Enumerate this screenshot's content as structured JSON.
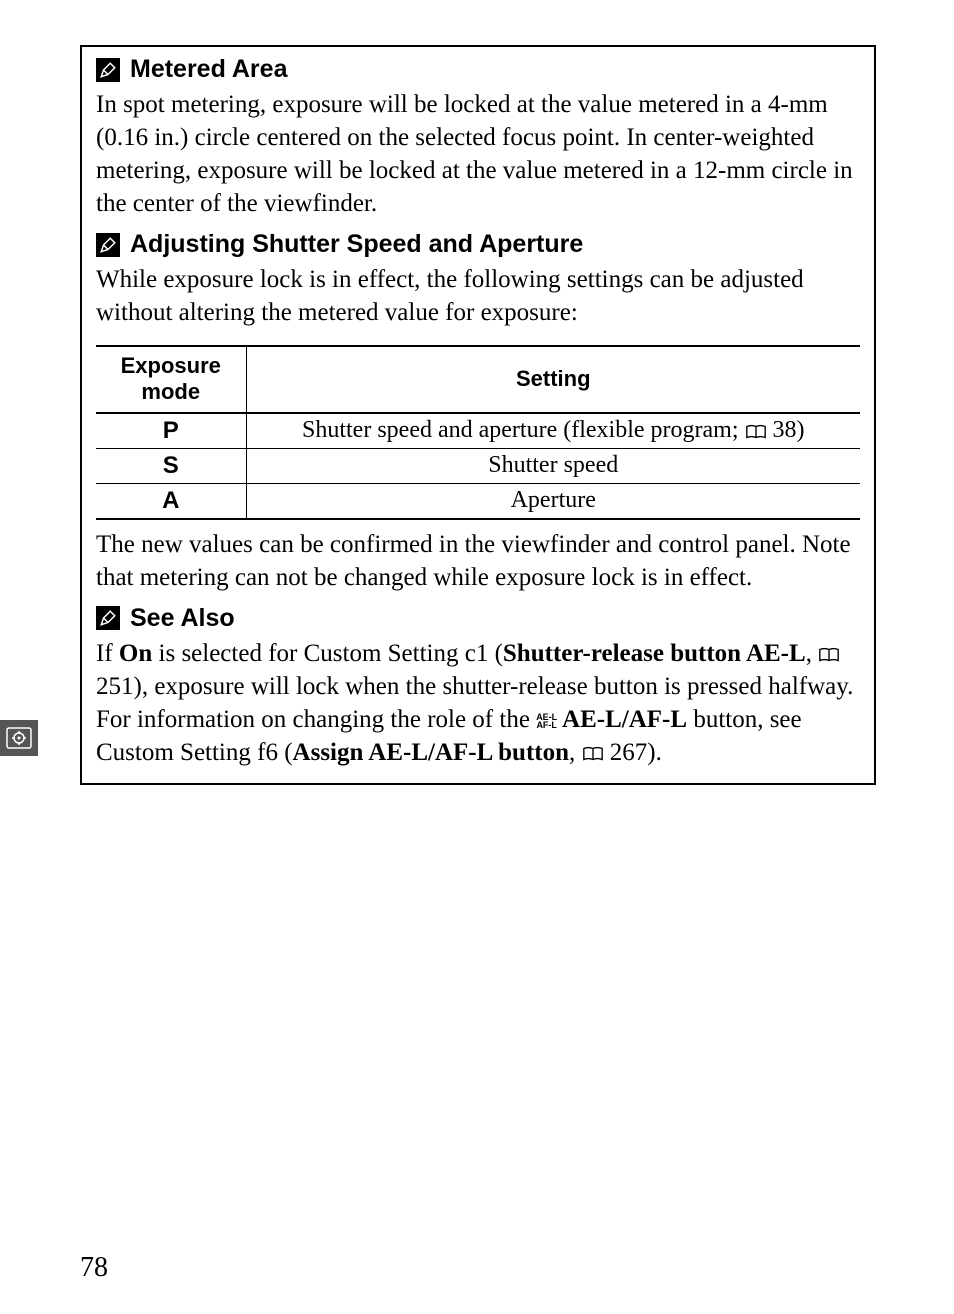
{
  "sections": {
    "metered": {
      "title": "Metered Area",
      "body": "In spot metering, exposure will be locked at the value metered in a 4-mm (0.16 in.) circle centered on the selected focus point. In center-weighted metering, exposure will be locked at the value metered in a 12-mm circle in the center of the viewfinder."
    },
    "adjusting": {
      "title": "Adjusting Shutter Speed and Aperture",
      "intro": "While exposure lock is in effect, the following settings can be adjusted without altering the metered value for exposure:",
      "after": "The new values can be confirmed in the viewfinder and control panel. Note that metering can not be changed while exposure lock is in effect."
    },
    "seealso": {
      "title": "See Also",
      "p1a": "If ",
      "p1_on": "On",
      "p1b": " is selected for Custom Setting c1 (",
      "p1_srb": "Shutter-release button AE-L",
      "p1c": ", ",
      "ref1": " 251), exposure will lock when the shutter-release button is pressed halfway.  For information on changing the role of the ",
      "aelabel": " AE-L/AF-L",
      "after_ael": " button, see Custom Setting f6 (",
      "assign": "Assign AE-L/AF-L button",
      "p2": ", ",
      "ref2": " 267)."
    }
  },
  "table": {
    "headers": {
      "mode": "Exposure mode",
      "setting": "Setting"
    },
    "rows": [
      {
        "mode": "P",
        "setting_pre": "Shutter speed and aperture (flexible program; ",
        "ref": " 38)"
      },
      {
        "mode": "S",
        "setting": "Shutter speed"
      },
      {
        "mode": "A",
        "setting": "Aperture"
      }
    ]
  },
  "icons": {
    "ael_top": "AE-L",
    "ael_bot": "AF-L"
  },
  "page_number": "78"
}
